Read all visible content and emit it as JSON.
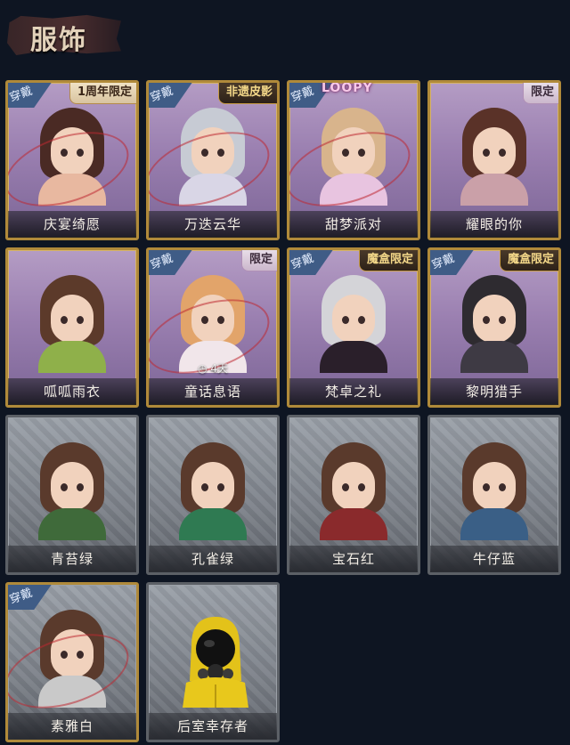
{
  "header": {
    "title": "服饰"
  },
  "tags": {
    "wear": "穿戴",
    "anniv": "1周年限定",
    "heritage": "非遗皮影",
    "limited": "限定",
    "magic": "魔盒限定",
    "brand": "LOOPY"
  },
  "costumes": [
    {
      "name": "庆宴绮愿"
    },
    {
      "name": "万迭云华"
    },
    {
      "name": "甜梦派对"
    },
    {
      "name": "耀眼的你"
    },
    {
      "name": "呱呱雨衣"
    },
    {
      "name": "童话息语",
      "timer": "◷ 4天"
    },
    {
      "name": "梵卓之礼"
    },
    {
      "name": "黎明猎手"
    },
    {
      "name": "青苔绿"
    },
    {
      "name": "孔雀绿"
    },
    {
      "name": "宝石红"
    },
    {
      "name": "牛仔蓝"
    },
    {
      "name": "素雅白"
    },
    {
      "name": "后室幸存者"
    }
  ],
  "colors": {
    "background": "#0e1522",
    "rare_card": "#9a7fb0",
    "common_card": "#7b8088",
    "wear_tag": "#3f5c86"
  }
}
